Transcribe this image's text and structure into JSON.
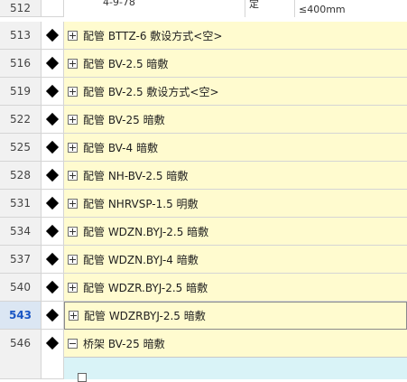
{
  "top_row": {
    "number": "512",
    "code": "4-9-78",
    "unit_fragment": "定",
    "spec": "≤400mm"
  },
  "rows": [
    {
      "number": "513",
      "label": "配管 BTTZ-6 敷设方式<空>",
      "expanded": false,
      "selected": false
    },
    {
      "number": "516",
      "label": "配管 BV-2.5 暗敷",
      "expanded": false,
      "selected": false
    },
    {
      "number": "519",
      "label": "配管 BV-2.5 敷设方式<空>",
      "expanded": false,
      "selected": false
    },
    {
      "number": "522",
      "label": "配管 BV-25 暗敷",
      "expanded": false,
      "selected": false
    },
    {
      "number": "525",
      "label": "配管 BV-4 暗敷",
      "expanded": false,
      "selected": false
    },
    {
      "number": "528",
      "label": "配管 NH-BV-2.5 暗敷",
      "expanded": false,
      "selected": false
    },
    {
      "number": "531",
      "label": "配管 NHRVSP-1.5 明敷",
      "expanded": false,
      "selected": false
    },
    {
      "number": "534",
      "label": "配管 WDZN.BYJ-2.5 暗敷",
      "expanded": false,
      "selected": false
    },
    {
      "number": "537",
      "label": "配管 WDZN.BYJ-4 暗敷",
      "expanded": false,
      "selected": false
    },
    {
      "number": "540",
      "label": "配管 WDZR.BYJ-2.5 暗敷",
      "expanded": false,
      "selected": false
    },
    {
      "number": "543",
      "label": "配管 WDZRBYJ-2.5 暗敷",
      "expanded": false,
      "selected": true
    },
    {
      "number": "546",
      "label": "桥架 BV-25 暗敷",
      "expanded": true,
      "selected": false
    }
  ],
  "colors": {
    "row_bg": "#fffbcf",
    "gutter_bg": "#f1f1f1",
    "selected_number": "#1a56c4",
    "change_marker": "#4caf50",
    "child_row_bg": "#d9f3f7"
  }
}
